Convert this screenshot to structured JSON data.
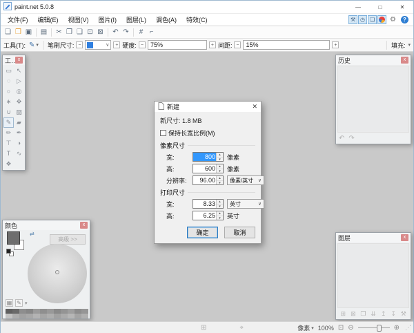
{
  "window": {
    "title": "paint.net 5.0.8"
  },
  "glyphs": {
    "min": "—",
    "max": "□",
    "close": "✕",
    "close_small": "x",
    "up": "▴",
    "down": "▾",
    "chevron": "∨",
    "caret": "▾",
    "swap": "⇄",
    "undo": "↶",
    "redo": "↷",
    "gear": "⚙",
    "help": "?",
    "brush": "✎",
    "minus": "−",
    "plus": "+",
    "fit": "⊡",
    "zoom_out": "⊖",
    "zoom_in": "⊕",
    "grip": "⋰"
  },
  "menu": {
    "items": [
      "文件(F)",
      "编辑(E)",
      "视图(V)",
      "图片(I)",
      "图层(L)",
      "调色(A)",
      "特效(C)"
    ],
    "panel_toggles": [
      {
        "name": "toggle-tools-button",
        "icon": "tools-icon",
        "glyph": "⚒"
      },
      {
        "name": "toggle-history-button",
        "icon": "history-icon",
        "glyph": "◷"
      },
      {
        "name": "toggle-layers-button",
        "icon": "layers-icon",
        "glyph": "❏"
      },
      {
        "name": "toggle-colors-button",
        "icon": "colors-icon",
        "glyph": "",
        "pie": true
      }
    ]
  },
  "toolbar": {
    "icons": [
      {
        "name": "new",
        "glyph": "❏"
      },
      {
        "name": "open",
        "glyph": "❒",
        "color": "#e8a33d"
      },
      {
        "name": "save",
        "glyph": "▣"
      },
      {
        "sep": true
      },
      {
        "name": "print",
        "glyph": "▤"
      },
      {
        "sep": true
      },
      {
        "name": "cut",
        "glyph": "✂"
      },
      {
        "name": "copy",
        "glyph": "❐"
      },
      {
        "name": "paste",
        "glyph": "❑"
      },
      {
        "name": "crop",
        "glyph": "⊡"
      },
      {
        "name": "deselect",
        "glyph": "⊠"
      },
      {
        "sep": true
      },
      {
        "name": "undo",
        "glyph": "↶"
      },
      {
        "name": "redo",
        "glyph": "↷"
      },
      {
        "sep": true
      },
      {
        "name": "grid",
        "glyph": "#"
      },
      {
        "name": "ruler",
        "glyph": "⌐"
      }
    ]
  },
  "tool_options": {
    "tool_label": "工具(T):",
    "brush_size_label": "笔刷尺寸:",
    "hardness_label": "硬度:",
    "hardness_value": "75%",
    "spacing_label": "间距:",
    "spacing_value": "15%",
    "fill_label": "填充:"
  },
  "panels": {
    "tools": {
      "title": "工具",
      "items": [
        {
          "name": "rectangle-select",
          "glyph": "▭"
        },
        {
          "name": "move-selected-pixels",
          "glyph": "↖"
        },
        {
          "name": "lasso-select",
          "glyph": "◌"
        },
        {
          "name": "move-selection",
          "glyph": "▷"
        },
        {
          "name": "ellipse-select",
          "glyph": "○"
        },
        {
          "name": "zoom",
          "glyph": "◎"
        },
        {
          "name": "magic-wand",
          "glyph": "∗"
        },
        {
          "name": "pan",
          "glyph": "✥"
        },
        {
          "name": "paint-bucket",
          "glyph": "∪"
        },
        {
          "name": "gradient",
          "glyph": "▨"
        },
        {
          "name": "paintbrush",
          "glyph": "✎",
          "selected": true
        },
        {
          "name": "eraser",
          "glyph": "▰"
        },
        {
          "name": "pencil",
          "glyph": "✏"
        },
        {
          "name": "color-picker",
          "glyph": "✒"
        },
        {
          "name": "clone-stamp",
          "glyph": "⊤"
        },
        {
          "name": "recolor",
          "glyph": "◑"
        },
        {
          "name": "text",
          "glyph": "T"
        },
        {
          "name": "line-curve",
          "glyph": "∿"
        },
        {
          "name": "shapes",
          "glyph": "❖"
        }
      ]
    },
    "history": {
      "title": "历史"
    },
    "layers": {
      "title": "图层",
      "buttons": [
        {
          "name": "add-layer",
          "glyph": "⊞"
        },
        {
          "name": "delete-layer",
          "glyph": "⊠"
        },
        {
          "name": "duplicate-layer",
          "glyph": "❐"
        },
        {
          "name": "merge-layer-down",
          "glyph": "⇊"
        },
        {
          "name": "move-layer-up",
          "glyph": "↥"
        },
        {
          "name": "move-layer-down",
          "glyph": "↧"
        },
        {
          "name": "layer-properties",
          "glyph": "⚒"
        }
      ]
    },
    "colors": {
      "title": "颜色",
      "advanced_label": "高级 >>",
      "primary_color": "#6e6e6e",
      "secondary_color": "#ffffff",
      "buttons": [
        {
          "name": "palette-swatches-button",
          "glyph": "▦"
        },
        {
          "name": "palette-menu-button",
          "glyph": "✎"
        }
      ],
      "palette_row1": [
        "#606060",
        "#6a6a6a",
        "#8e8e8e",
        "#878787",
        "#9b9b9b",
        "#8f8f8f",
        "#999999",
        "#8a8a8a",
        "#949494",
        "#9f9f9f",
        "#8d8d8d",
        "#969696"
      ],
      "palette_row2": [
        "#c2c2c2",
        "#adadad",
        "#a2a2a2",
        "#a8a8a8",
        "#b3b3b3",
        "#a6a6a6",
        "#aeaeae",
        "#a1a1a1",
        "#ababab",
        "#b6b6b6",
        "#a4a4a4",
        "#b0b0b0"
      ]
    }
  },
  "dialog": {
    "title": "新建",
    "new_size_label": "新尺寸:",
    "new_size_value": "1.8 MB",
    "checkbox_label": "保持长宽比例(M)",
    "pixel_group": "像素尺寸",
    "print_group": "打印尺寸",
    "pixel_fields": [
      {
        "name": "pixel-width",
        "label": "宽:",
        "value": "800",
        "selected": true,
        "unit": "像素",
        "combo": false
      },
      {
        "name": "pixel-height",
        "label": "高:",
        "value": "600",
        "unit": "像素",
        "combo": false
      },
      {
        "name": "resolution",
        "label": "分辨率:",
        "value": "96.00",
        "unit": "像素/英寸",
        "combo": true
      }
    ],
    "print_fields": [
      {
        "name": "print-width",
        "label": "宽:",
        "value": "8.33",
        "unit": "英寸",
        "combo": true
      },
      {
        "name": "print-height",
        "label": "高:",
        "value": "6.25",
        "unit": "英寸",
        "combo": false
      }
    ],
    "ok": "确定",
    "cancel": "取消"
  },
  "statusbar": {
    "mid_icons": [
      {
        "name": "selection-size",
        "glyph": "⊞"
      },
      {
        "name": "cursor-position",
        "glyph": "⌖"
      }
    ],
    "unit": "像素",
    "zoom": "100%"
  },
  "colors_meta": {
    "accent": "#2f7fe0",
    "selection_blue": "#3297fd",
    "panel_close_red": "#d98989",
    "workspace_bg": "#c9c9c9"
  }
}
